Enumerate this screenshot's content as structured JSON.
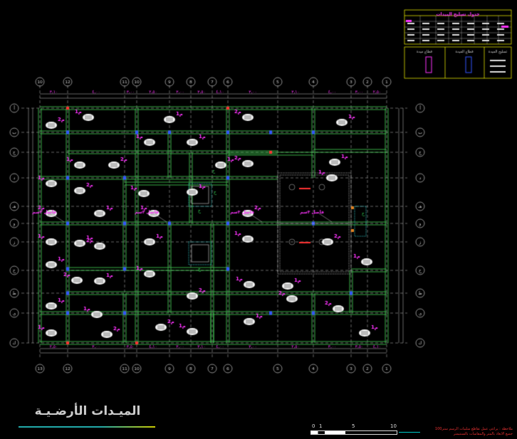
{
  "drawing": {
    "title": "الميـدات الأرضـيـة",
    "scale_labels": [
      "0",
      "1",
      "5",
      "10"
    ],
    "note_lines": [
      "ملاحظة : يراعى عمل تقاطع سلبيات الرسم ستر100",
      "جميع الابعاد بالمتر والمقاسات بالسنتيمتر"
    ]
  },
  "grid": {
    "top_axis_labels": [
      "10",
      "12",
      "11",
      "10",
      "9",
      "8",
      "7",
      "6",
      "5",
      "4",
      "3",
      "2",
      "1"
    ],
    "bottom_axis_labels": [
      "13",
      "12",
      "11",
      "10",
      "9",
      "8",
      "7",
      "6",
      "5",
      "4",
      "3",
      "2",
      "1"
    ],
    "left_axis_labels": [
      "أ",
      "ب",
      "ج",
      "د",
      "هـ",
      "و",
      "ز",
      "ح",
      "ط",
      "ي",
      "ك",
      "ل",
      "م"
    ]
  },
  "annotations": {
    "beam_tag": "م1",
    "footing_tag": "م2",
    "joint_labels": [
      "فاصل ٣سم",
      "فاصل ٣سم",
      "فاصل ٣سم",
      "فاصل ٣سم"
    ],
    "dim_labels": [
      "٣,١٠",
      "٤,٠٠",
      "٣,٠٠",
      "٢,٥٠",
      "٣,٠٠",
      "٣,٥٠",
      "٤,١٠",
      "٣,٠٠"
    ]
  },
  "legend": {
    "table_title": "جدول تسليح الميدات",
    "section_titles": [
      "قطاع ميدة",
      "قطاع الميدة",
      "تسليح الميدة"
    ]
  },
  "colors": {
    "background": "#000000",
    "beam": "#3fbf4f",
    "grid": "#c8c8c8",
    "label": "#ff33ff",
    "column": "#3355ff",
    "hatch": "#ffffff",
    "accent": "#ffff00",
    "red": "#ff3333"
  }
}
